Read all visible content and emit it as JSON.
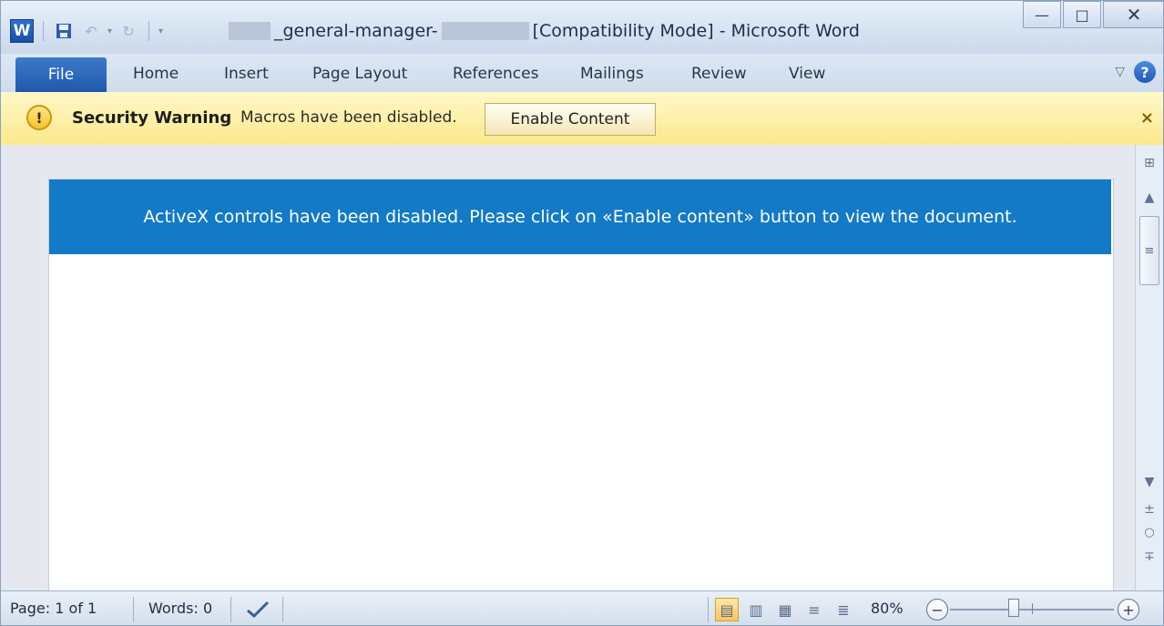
{
  "window": {
    "title": {
      "suffix": "_general-manager-",
      "mode": "[Compatibility Mode] - Microsoft Word"
    },
    "controls": {
      "minimize": "—",
      "maximize": "□",
      "close": "✕"
    }
  },
  "qat": {
    "logo": "W",
    "icons": [
      "save-icon",
      "undo-icon",
      "redo-icon",
      "customize-qat-icon"
    ]
  },
  "ribbon": {
    "tabs": [
      {
        "label": "File"
      },
      {
        "label": "Home"
      },
      {
        "label": "Insert"
      },
      {
        "label": "Page Layout"
      },
      {
        "label": "References"
      },
      {
        "label": "Mailings"
      },
      {
        "label": "Review"
      },
      {
        "label": "View"
      }
    ],
    "help": "?"
  },
  "security_bar": {
    "icon": "!",
    "title": "Security Warning",
    "message": "Macros have been disabled.",
    "button_label": "Enable Content",
    "close": "×"
  },
  "document": {
    "banner_text": "ActiveX controls have been disabled. Please click on «Enable content» button to view the document.",
    "banner_color": "#127ac7"
  },
  "status_bar": {
    "page": "Page: 1 of 1",
    "words": "Words: 0",
    "zoom": "80%",
    "zoom_level": 80,
    "zoom_minus": "−",
    "zoom_plus": "+",
    "view_modes": [
      "print-layout",
      "full-screen-reading",
      "web-layout",
      "outline",
      "draft"
    ],
    "active_view": "print-layout"
  }
}
